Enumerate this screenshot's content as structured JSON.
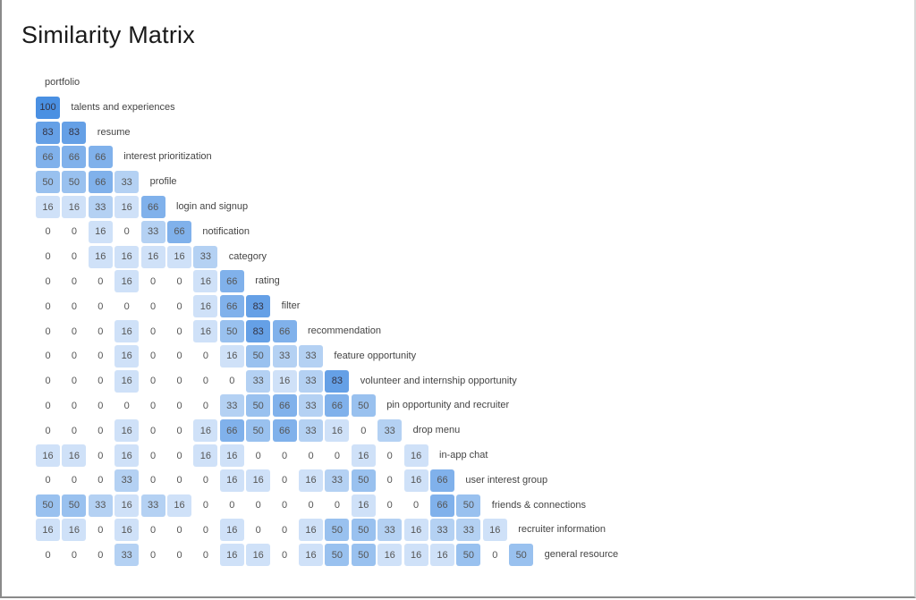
{
  "title": "Similarity Matrix",
  "chart_data": {
    "type": "heatmap",
    "title": "Similarity Matrix",
    "layout": "lower-triangular",
    "value_range": [
      0,
      100
    ],
    "color_low": "#ffffff",
    "color_high": "#4a90e2",
    "labels": [
      "portfolio",
      "talents and experiences",
      "resume",
      "interest prioritization",
      "profile",
      "login and signup",
      "notification",
      "category",
      "rating",
      "filter",
      "recommendation",
      "feature opportunity",
      "volunteer and internship opportunity",
      "pin opportunity and recruiter",
      "drop menu",
      "in-app chat",
      "user interest group",
      "friends & connections",
      "recruiter information",
      "general resource"
    ],
    "rows": [
      [],
      [
        100
      ],
      [
        83,
        83
      ],
      [
        66,
        66,
        66
      ],
      [
        50,
        50,
        66,
        33
      ],
      [
        16,
        16,
        33,
        16,
        66
      ],
      [
        0,
        0,
        16,
        0,
        33,
        66
      ],
      [
        0,
        0,
        16,
        16,
        16,
        16,
        33
      ],
      [
        0,
        0,
        0,
        16,
        0,
        0,
        16,
        66
      ],
      [
        0,
        0,
        0,
        0,
        0,
        0,
        16,
        66,
        83
      ],
      [
        0,
        0,
        0,
        16,
        0,
        0,
        16,
        50,
        83,
        66
      ],
      [
        0,
        0,
        0,
        16,
        0,
        0,
        0,
        16,
        50,
        33,
        33
      ],
      [
        0,
        0,
        0,
        16,
        0,
        0,
        0,
        0,
        33,
        16,
        33,
        83
      ],
      [
        0,
        0,
        0,
        0,
        0,
        0,
        0,
        33,
        50,
        66,
        33,
        66,
        50
      ],
      [
        0,
        0,
        0,
        16,
        0,
        0,
        16,
        66,
        50,
        66,
        33,
        16,
        0,
        33
      ],
      [
        16,
        16,
        0,
        16,
        0,
        0,
        16,
        16,
        0,
        0,
        0,
        0,
        16,
        0,
        16
      ],
      [
        0,
        0,
        0,
        33,
        0,
        0,
        0,
        16,
        16,
        0,
        16,
        33,
        50,
        0,
        16,
        66
      ],
      [
        50,
        50,
        33,
        16,
        33,
        16,
        0,
        0,
        0,
        0,
        0,
        0,
        16,
        0,
        0,
        66,
        50
      ],
      [
        16,
        16,
        0,
        16,
        0,
        0,
        0,
        16,
        0,
        0,
        16,
        50,
        50,
        33,
        16,
        33,
        33,
        16
      ],
      [
        0,
        0,
        0,
        33,
        0,
        0,
        0,
        16,
        16,
        0,
        16,
        50,
        50,
        16,
        16,
        16,
        50,
        0,
        50
      ]
    ]
  }
}
